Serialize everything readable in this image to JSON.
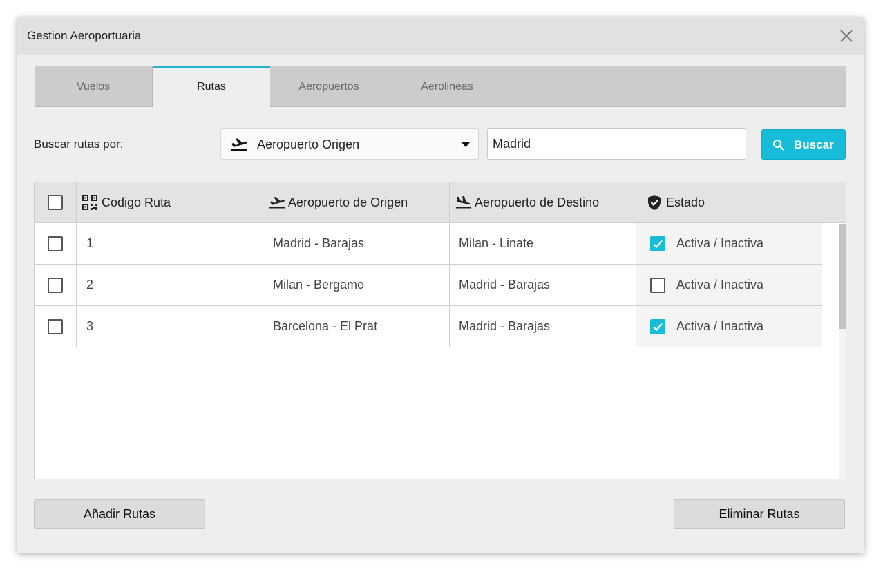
{
  "window": {
    "title": "Gestion Aeroportuaria"
  },
  "tabs": [
    {
      "label": "Vuelos",
      "active": false
    },
    {
      "label": "Rutas",
      "active": true
    },
    {
      "label": "Aeropuertos",
      "active": false
    },
    {
      "label": "Aerolineas",
      "active": false
    }
  ],
  "search": {
    "label": "Buscar rutas por:",
    "field_selected": "Aeropuerto Origen",
    "field_icon": "flight-takeoff-icon",
    "query": "Madrid",
    "button_label": "Buscar",
    "button_icon": "search-icon"
  },
  "grid": {
    "columns": [
      {
        "label": "Codigo Ruta",
        "icon": "qr-code-icon"
      },
      {
        "label": "Aeropuerto de Origen",
        "icon": "flight-takeoff-icon"
      },
      {
        "label": "Aeropuerto de Destino",
        "icon": "flight-land-icon"
      },
      {
        "label": "Estado",
        "icon": "shield-check-icon"
      }
    ],
    "rows": [
      {
        "codigo": "1",
        "origen": "Madrid - Barajas",
        "destino": "Milan - Linate",
        "estado_label": "Activa / Inactiva",
        "activa": true
      },
      {
        "codigo": "2",
        "origen": "Milan - Bergamo",
        "destino": "Madrid - Barajas",
        "estado_label": "Activa / Inactiva",
        "activa": false
      },
      {
        "codigo": "3",
        "origen": "Barcelona - El Prat",
        "destino": "Madrid - Barajas",
        "estado_label": "Activa / Inactiva",
        "activa": true
      }
    ]
  },
  "footer": {
    "add_label": "Añadir Rutas",
    "delete_label": "Eliminar Rutas"
  },
  "colors": {
    "accent": "#17bcd8",
    "window_bg": "#eeeeee",
    "titlebar_bg": "#e1e1e1",
    "tabbar_bg": "#cccccc"
  }
}
